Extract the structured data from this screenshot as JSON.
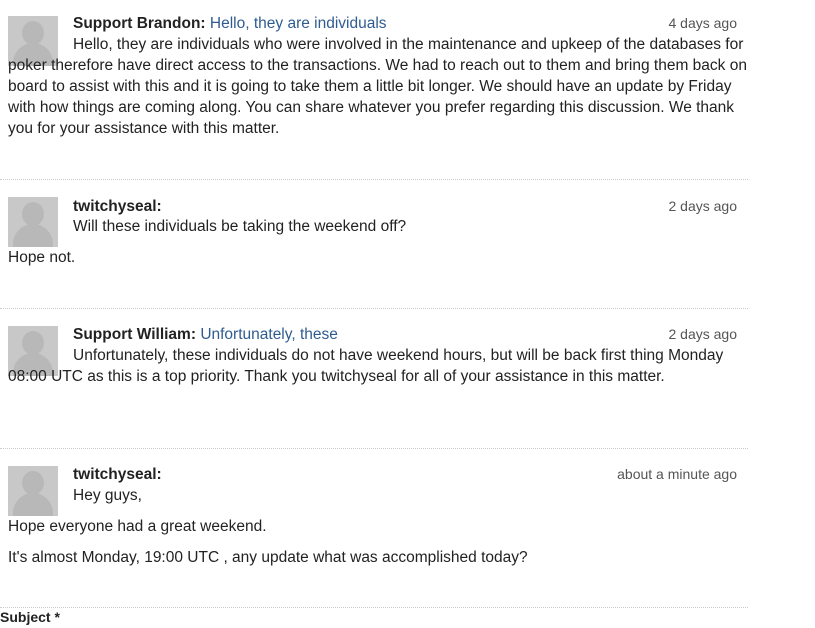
{
  "comments": [
    {
      "author": "Support Brandon:",
      "subject": "Hello, they are individuals",
      "time": "4 days ago",
      "body": "Hello, they are individuals who were involved in the maintenance and upkeep of the databases for poker therefore have direct access to the transactions. We had to reach out to them and bring them back on board to assist with this and it is going to take them a little bit longer. We should have an update by Friday with how things are coming along. You can share whatever you prefer regarding this discussion. We thank you for your assistance with this matter."
    },
    {
      "author": "twitchyseal:",
      "time": "2 days ago",
      "lines": [
        "Will these individuals be taking the weekend off?",
        "Hope not."
      ]
    },
    {
      "author": "Support William:",
      "subject": "Unfortunately, these",
      "time": "2 days ago",
      "body": "Unfortunately, these individuals do not have weekend hours, but will be back first thing Monday 08:00 UTC as this is a top priority. Thank you twitchyseal for all of your assistance in this matter."
    },
    {
      "author": "twitchyseal:",
      "time": "about a minute ago",
      "lines": [
        "Hey guys,",
        "Hope everyone had a great weekend.",
        "It's almost Monday, 19:00 UTC , any update what was accomplished today?"
      ]
    }
  ],
  "form": {
    "subject_label": "Subject *"
  },
  "icons": {
    "avatar": "default-user-avatar-icon"
  }
}
